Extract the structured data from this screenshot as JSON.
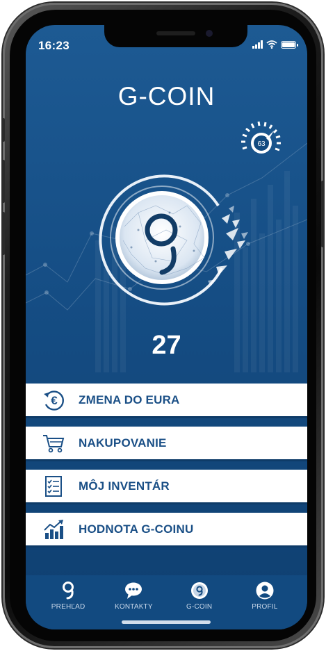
{
  "status_bar": {
    "time": "16:23"
  },
  "header": {
    "title": "G-COIN"
  },
  "gauge": {
    "value": "63"
  },
  "balance": {
    "value": "27"
  },
  "menu": {
    "items": [
      {
        "label": "ZMENA DO EURA",
        "icon": "euro-exchange-icon"
      },
      {
        "label": "NAKUPOVANIE",
        "icon": "shopping-cart-icon"
      },
      {
        "label": "MÔJ INVENTÁR",
        "icon": "checklist-icon"
      },
      {
        "label": "HODNOTA G-COINU",
        "icon": "growth-chart-icon"
      }
    ]
  },
  "bottom_nav": {
    "items": [
      {
        "label": "PREHĽAD",
        "icon": "g-logo-icon"
      },
      {
        "label": "KONTAKTY",
        "icon": "chat-bubble-icon"
      },
      {
        "label": "G-COIN",
        "icon": "g-coin-icon"
      },
      {
        "label": "PROFIL",
        "icon": "user-icon"
      }
    ]
  },
  "colors": {
    "primary": "#154d84",
    "nav_background": "#124a80",
    "menu_text": "#1a4f86",
    "menu_background": "#ffffff"
  }
}
